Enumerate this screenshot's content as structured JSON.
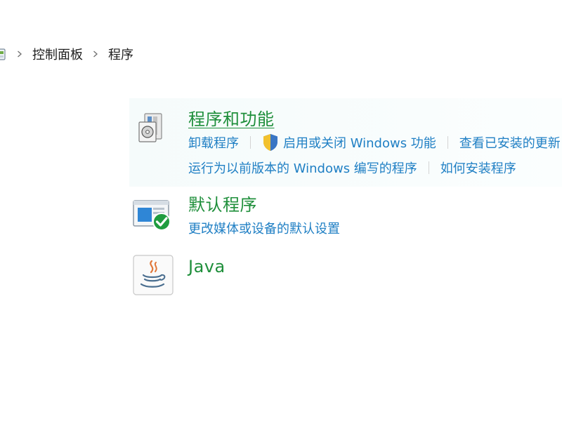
{
  "breadcrumb": {
    "items": [
      "控制面板",
      "程序"
    ]
  },
  "groups": {
    "programs_features": {
      "title": "程序和功能",
      "links": {
        "uninstall": "卸载程序",
        "toggle_features": "启用或关闭 Windows 功能",
        "view_updates": "查看已安装的更新",
        "run_legacy": "运行为以前版本的 Windows 编写的程序",
        "how_to_install": "如何安装程序"
      }
    },
    "default_programs": {
      "title": "默认程序",
      "links": {
        "change_defaults": "更改媒体或设备的默认设置"
      }
    },
    "java": {
      "title": "Java"
    }
  },
  "colors": {
    "title_green": "#1f8f3b",
    "link_blue": "#1f7fc4",
    "separator": "#d4d4d4",
    "highlight_bg": "#f5fbfb"
  },
  "icons": {
    "breadcrumb_root": "control-panel-icon",
    "separator": "chevron-right-icon",
    "programs_features": "programs-box-icon",
    "shield": "uac-shield-icon",
    "default_programs": "default-programs-check-icon",
    "java": "java-cup-icon"
  }
}
